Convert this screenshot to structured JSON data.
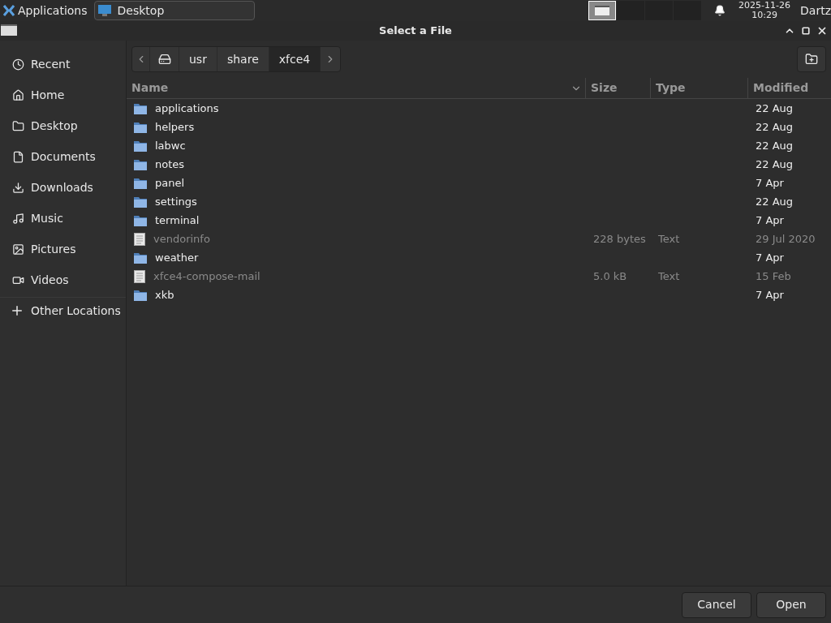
{
  "taskbar": {
    "menu": "Applications",
    "tasks": [
      {
        "label": "Desktop",
        "selected": true
      }
    ],
    "workspaces": [
      {
        "selected": true
      },
      {
        "selected": false
      },
      {
        "selected": false
      },
      {
        "selected": false
      }
    ],
    "date": "2025-11-26",
    "time": "10:29",
    "user": "Dartz"
  },
  "window": {
    "title": "Select a File"
  },
  "breadcrumb": [
    {
      "label": "usr",
      "selected": false
    },
    {
      "label": "share",
      "selected": false
    },
    {
      "label": "xfce4",
      "selected": true
    }
  ],
  "sidebar": {
    "items": [
      {
        "kind": "recent",
        "label": "Recent"
      },
      {
        "kind": "home",
        "label": "Home"
      },
      {
        "kind": "folder",
        "label": "Desktop"
      },
      {
        "kind": "document",
        "label": "Documents"
      },
      {
        "kind": "download",
        "label": "Downloads"
      },
      {
        "kind": "music",
        "label": "Music"
      },
      {
        "kind": "picture",
        "label": "Pictures"
      },
      {
        "kind": "video",
        "label": "Videos"
      }
    ],
    "other": {
      "label": "Other Locations"
    }
  },
  "table": {
    "columns": [
      "Name",
      "Size",
      "Type",
      "Modified"
    ],
    "rows": [
      {
        "kind": "folder",
        "name": "applications",
        "modified": "22 Aug"
      },
      {
        "kind": "folder",
        "name": "helpers",
        "modified": "22 Aug"
      },
      {
        "kind": "folder",
        "name": "labwc",
        "modified": "22 Aug"
      },
      {
        "kind": "folder",
        "name": "notes",
        "modified": "22 Aug"
      },
      {
        "kind": "folder",
        "name": "panel",
        "modified": "7 Apr"
      },
      {
        "kind": "folder",
        "name": "settings",
        "modified": "22 Aug"
      },
      {
        "kind": "folder",
        "name": "terminal",
        "modified": "7 Apr"
      },
      {
        "kind": "file",
        "name": "vendorinfo",
        "size": "228 bytes",
        "type": "Text",
        "modified": "29 Jul 2020"
      },
      {
        "kind": "folder",
        "name": "weather",
        "modified": "7 Apr"
      },
      {
        "kind": "file",
        "name": "xfce4-compose-mail",
        "size": "5.0 kB",
        "type": "Text",
        "modified": "15 Feb"
      },
      {
        "kind": "folder",
        "name": "xkb",
        "modified": "7 Apr"
      }
    ]
  },
  "buttons": {
    "cancel": "Cancel",
    "open": "Open"
  }
}
